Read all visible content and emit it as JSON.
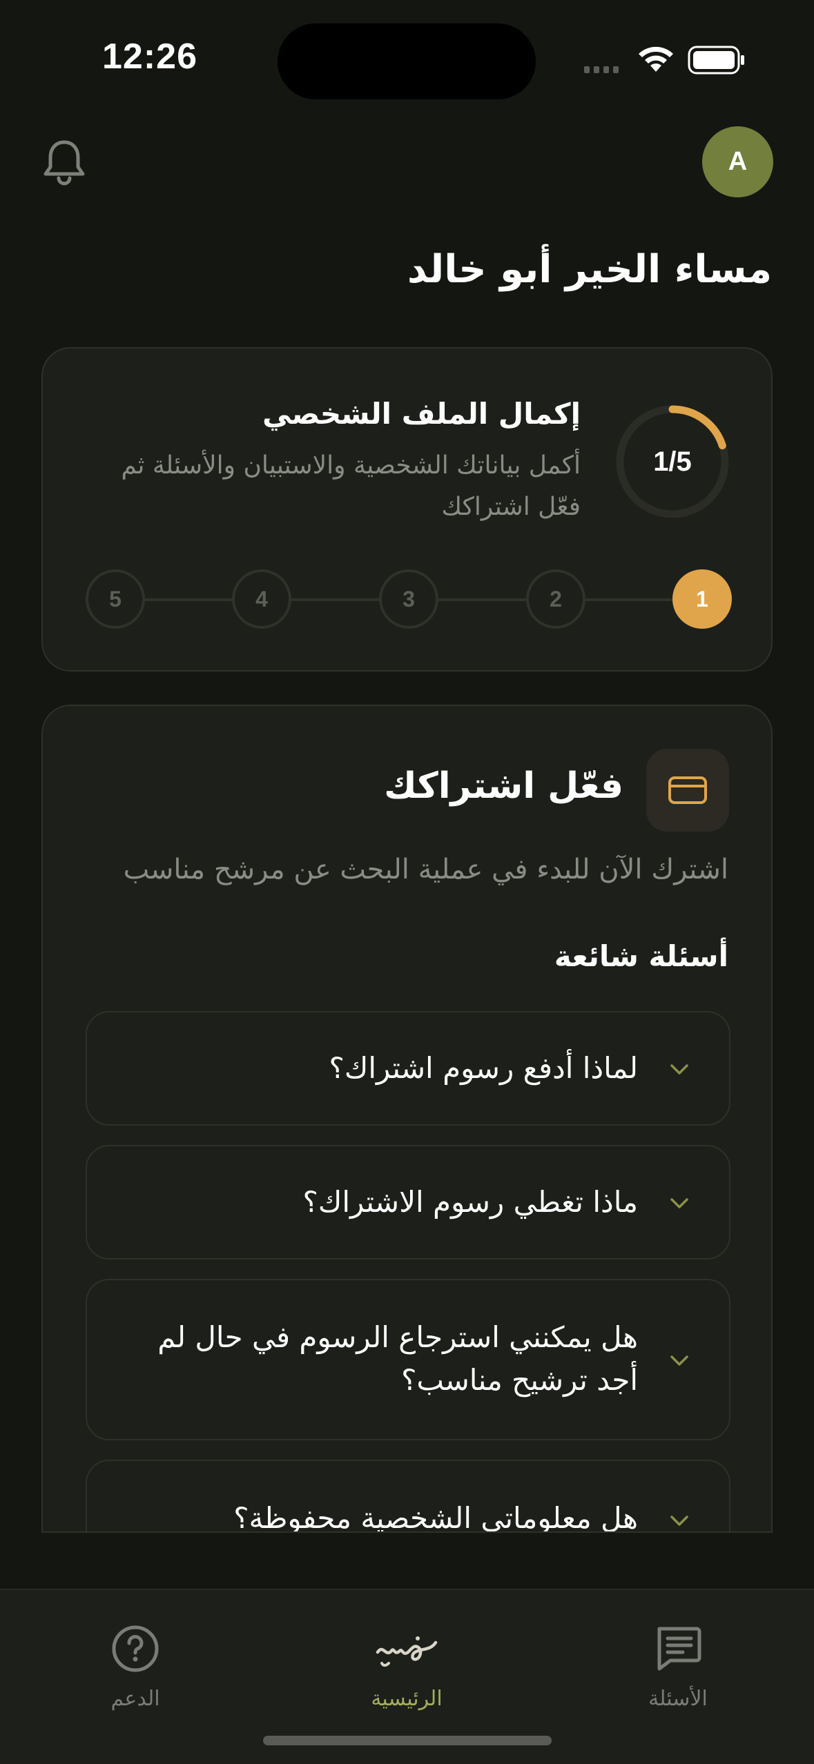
{
  "status_bar": {
    "time": "12:26"
  },
  "header": {
    "avatar_initial": "A",
    "greeting": "مساء الخير أبو خالد"
  },
  "profile_card": {
    "title": "إكمال الملف الشخصي",
    "description": "أكمل بياناتك الشخصية والاستبيان والأسئلة ثم فعّل اشتراكك",
    "progress_label": "1/5",
    "progress_fraction": 0.2,
    "steps": [
      "1",
      "2",
      "3",
      "4",
      "5"
    ],
    "active_step": 1
  },
  "subscription_card": {
    "title": "فعّل اشتراكك",
    "description": "اشترك الآن للبدء في عملية البحث عن مرشح مناسب",
    "faq_heading": "أسئلة شائعة",
    "faqs": [
      {
        "question": "لماذا أدفع رسوم اشتراك؟"
      },
      {
        "question": "ماذا تغطي رسوم الاشتراك؟"
      },
      {
        "question": "هل يمكنني استرجاع الرسوم في حال لم أجد ترشيح مناسب؟"
      },
      {
        "question": "هل معلوماتي الشخصية محفوظة؟"
      }
    ]
  },
  "tabbar": {
    "items": [
      {
        "label": "الأسئلة",
        "icon": "message-icon"
      },
      {
        "label": "الرئيسية",
        "icon": "home-logo-icon"
      },
      {
        "label": "الدعم",
        "icon": "help-circle-icon"
      }
    ],
    "active": "الرئيسية"
  },
  "colors": {
    "accent": "#e0a54a",
    "brand_green": "#737f3d",
    "active_tab": "#a3ad5c",
    "background": "#141612",
    "card": "#1d1f1a"
  }
}
